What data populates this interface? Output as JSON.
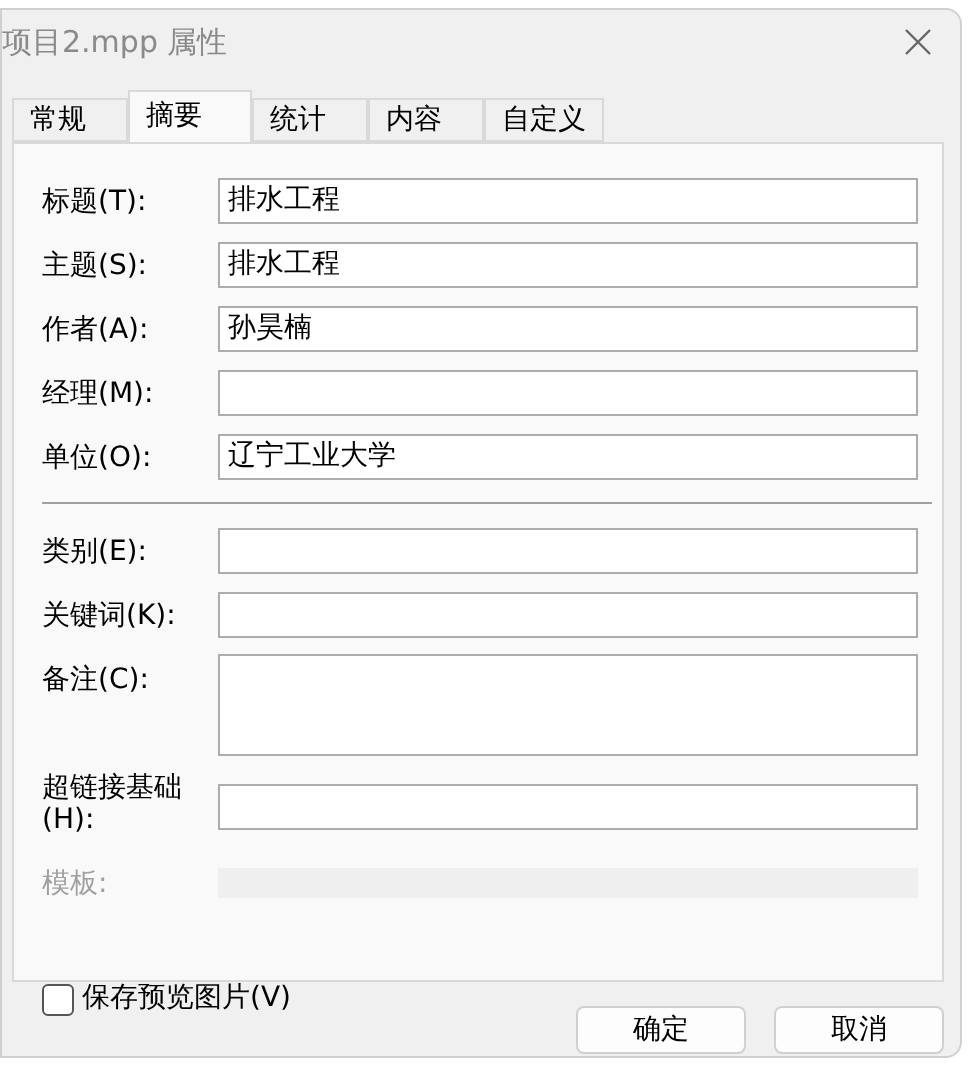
{
  "window": {
    "title": "项目2.mpp 属性"
  },
  "tabs": [
    {
      "label": "常规",
      "selected": false
    },
    {
      "label": "摘要",
      "selected": true
    },
    {
      "label": "统计",
      "selected": false
    },
    {
      "label": "内容",
      "selected": false
    },
    {
      "label": "自定义",
      "selected": false
    }
  ],
  "fields": [
    {
      "kind": "line",
      "label": "标题(T):",
      "value": "排水工程"
    },
    {
      "kind": "line",
      "label": "主题(S):",
      "value": "排水工程"
    },
    {
      "kind": "line",
      "label": "作者(A):",
      "value": "孙昊楠"
    },
    {
      "kind": "line",
      "label": "经理(M):"
    },
    {
      "kind": "line",
      "label": "单位(O):",
      "value": "辽宁工业大学"
    },
    {
      "kind": "separator"
    },
    {
      "kind": "line",
      "label": "类别(E):"
    },
    {
      "kind": "line",
      "label": "关键词(K):"
    },
    {
      "kind": "area",
      "label": "备注(C):"
    },
    {
      "kind": "line",
      "label": "超链接基础(H):"
    },
    {
      "kind": "disabled",
      "label": "模板:"
    }
  ],
  "save_preview": {
    "label": "保存预览图片(V)",
    "checked": false
  },
  "buttons": [
    "确定",
    "取消"
  ]
}
